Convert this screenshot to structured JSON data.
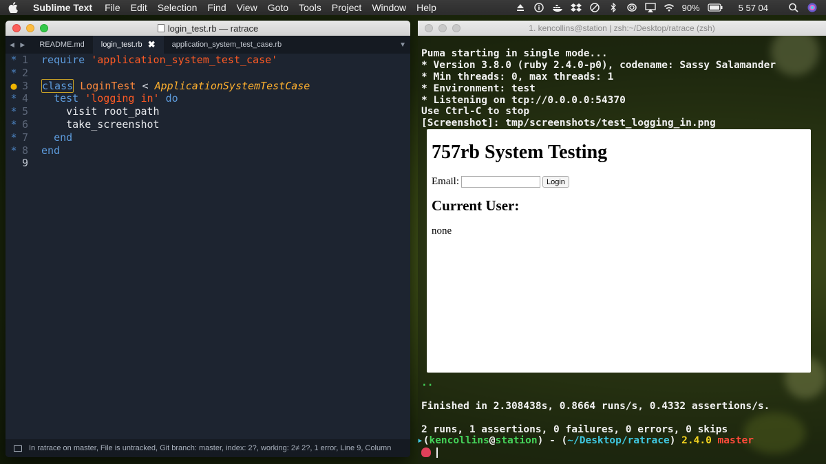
{
  "menubar": {
    "app": "Sublime Text",
    "items": [
      "File",
      "Edit",
      "Selection",
      "Find",
      "View",
      "Goto",
      "Tools",
      "Project",
      "Window",
      "Help"
    ],
    "battery": "90%",
    "clock": "5 57 04"
  },
  "sublime": {
    "window_title": "login_test.rb — ratrace",
    "tabs": [
      {
        "label": "README.md",
        "active": false
      },
      {
        "label": "login_test.rb",
        "active": true
      },
      {
        "label": "application_system_test_case.rb",
        "active": false
      }
    ],
    "gutter": [
      {
        "mark": "*",
        "num": "1"
      },
      {
        "mark": "*",
        "num": "2"
      },
      {
        "mark": "●",
        "num": "3"
      },
      {
        "mark": "*",
        "num": "4"
      },
      {
        "mark": "*",
        "num": "5"
      },
      {
        "mark": "*",
        "num": "6"
      },
      {
        "mark": "*",
        "num": "7"
      },
      {
        "mark": "*",
        "num": "8"
      },
      {
        "mark": "",
        "num": "9"
      }
    ],
    "code": {
      "l1_kw": "require",
      "l1_str": "'application_system_test_case'",
      "l3_kw": "class",
      "l3_cls": "LoginTest",
      "l3_op": "<",
      "l3_sup": "ApplicationSystemTestCase",
      "l4_kw": "test",
      "l4_str": "'logging in'",
      "l4_do": "do",
      "l5": "visit root_path",
      "l6": "take_screenshot",
      "l7": "end",
      "l8": "end"
    },
    "status": "In ratrace on master, File is untracked, Git branch: master, index: 2?, working: 2≠ 2?, 1 error, Line 9, Column"
  },
  "terminal": {
    "window_title": "1. kencollins@station | zsh:~/Desktop/ratrace (zsh)",
    "output": [
      "Puma starting in single mode...",
      "* Version 3.8.0 (ruby 2.4.0-p0), codename: Sassy Salamander",
      "* Min threads: 0, max threads: 1",
      "* Environment: test",
      "* Listening on tcp://0.0.0.0:54370",
      "Use Ctrl-C to stop",
      "[Screenshot]: tmp/screenshots/test_logging_in.png"
    ],
    "dots": "..",
    "finished": "Finished in 2.308438s, 0.8664 runs/s, 0.4332 assertions/s.",
    "summary": "2 runs, 1 assertions, 0 failures, 0 errors, 0 skips",
    "prompt": {
      "user": "kencollins",
      "at": "@",
      "host": "station",
      "sep": ") - (",
      "path": "~/Desktop/ratrace",
      "ruby": "2.4.0",
      "branch": "master"
    }
  },
  "browser_page": {
    "heading": "757rb System Testing",
    "email_label": "Email:",
    "login_button": "Login",
    "subheading": "Current User:",
    "current_user": "none"
  }
}
